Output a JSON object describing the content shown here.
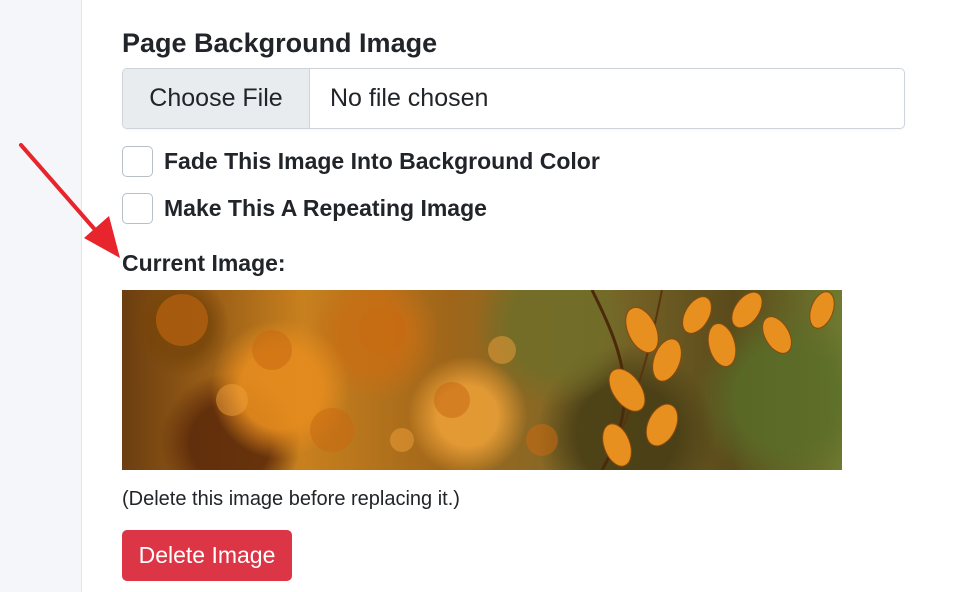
{
  "section": {
    "title": "Page Background Image"
  },
  "file_input": {
    "button_label": "Choose File",
    "status": "No file chosen"
  },
  "options": [
    {
      "label": "Fade This Image Into Background Color",
      "checked": false
    },
    {
      "label": "Make This A Repeating Image",
      "checked": false
    }
  ],
  "current_image": {
    "label": "Current Image:",
    "icon": "autumn-leaves-photo"
  },
  "note": "(Delete this image before replacing it.)",
  "delete_button": {
    "label": "Delete Image",
    "color": "#dc3545"
  },
  "annotation": {
    "icon": "red-arrow",
    "color": "#e8242c"
  }
}
